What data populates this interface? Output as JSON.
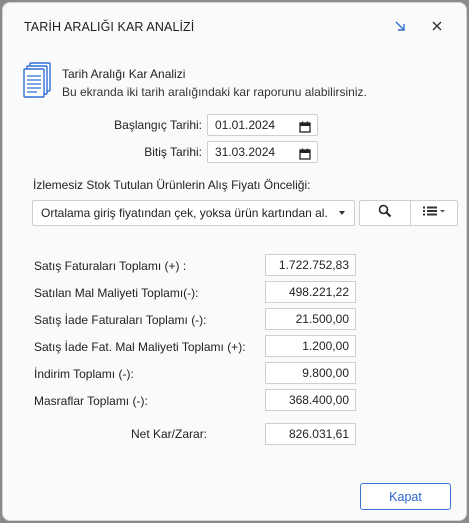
{
  "window": {
    "title": "TARİH ARALIĞI KAR ANALİZİ"
  },
  "info": {
    "title": "Tarih Aralığı Kar Analizi",
    "subtitle": "Bu ekranda iki tarih aralığındaki kar raporunu alabilirsiniz."
  },
  "dates": {
    "start_label": "Başlangıç Tarihi:",
    "start_value": "01.01.2024",
    "end_label": "Bitiş Tarihi:",
    "end_value": "31.03.2024"
  },
  "purchase_price": {
    "label": "İzlemesiz Stok Tutulan Ürünlerin Alış Fiyatı Önceliği:",
    "selected": "Ortalama giriş fiyatından çek, yoksa ürün kartından al."
  },
  "rows": [
    {
      "label": "Satış Faturaları Toplamı (+) :",
      "value": "1.722.752,83"
    },
    {
      "label": "Satılan Mal Maliyeti Toplamı(-):",
      "value": "498.221,22"
    },
    {
      "label": "Satış İade Faturaları Toplamı (-):",
      "value": "21.500,00"
    },
    {
      "label": "Satış İade Fat. Mal Maliyeti Toplamı (+):",
      "value": "1.200,00"
    },
    {
      "label": "İndirim Toplamı (-):",
      "value": "9.800,00"
    },
    {
      "label": "Masraflar Toplamı (-):",
      "value": "368.400,00"
    }
  ],
  "net": {
    "label": "Net Kar/Zarar:",
    "value": "826.031,61"
  },
  "footer": {
    "close_label": "Kapat"
  },
  "colors": {
    "accent": "#2a66cf",
    "background": "#fafafa",
    "border": "#cfcfcf"
  },
  "icons": {
    "shrink": "shrink-arrow-icon",
    "close": "close-icon",
    "info": "document-stack-icon",
    "calendar": "calendar-icon",
    "search": "search-icon",
    "list": "list-menu-icon"
  }
}
